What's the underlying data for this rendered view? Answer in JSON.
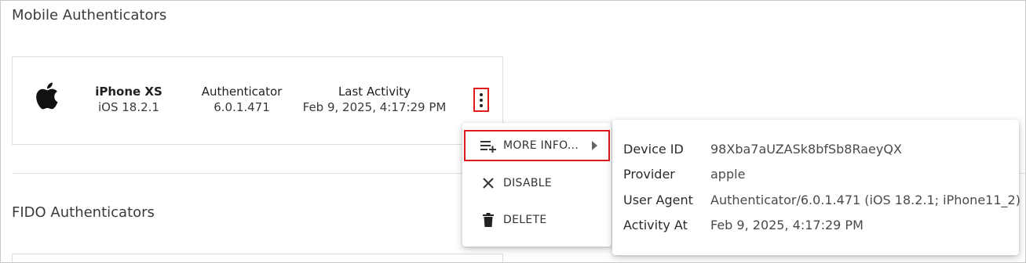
{
  "sections": {
    "mobile_title": "Mobile Authenticators",
    "fido_title": "FIDO Authenticators"
  },
  "device": {
    "icon": "apple-logo-icon",
    "name": "iPhone XS",
    "os": "iOS 18.2.1",
    "authenticator_label": "Authenticator",
    "authenticator_version": "6.0.1.471",
    "last_activity_label": "Last Activity",
    "last_activity_value": "Feb 9, 2025, 4:17:29 PM"
  },
  "menu": {
    "more_info": "MORE INFO...",
    "disable": "DISABLE",
    "delete": "DELETE"
  },
  "info": {
    "rows": [
      {
        "label": "Device ID",
        "value": "98Xba7aUZASk8bfSb8RaeyQX"
      },
      {
        "label": "Provider",
        "value": "apple"
      },
      {
        "label": "User Agent",
        "value": "Authenticator/6.0.1.471 (iOS 18.2.1; iPhone11_2)"
      },
      {
        "label": "Activity At",
        "value": "Feb 9, 2025, 4:17:29 PM"
      }
    ]
  },
  "colors": {
    "highlight": "#e01b1b",
    "divider": "#d9e4ea"
  }
}
